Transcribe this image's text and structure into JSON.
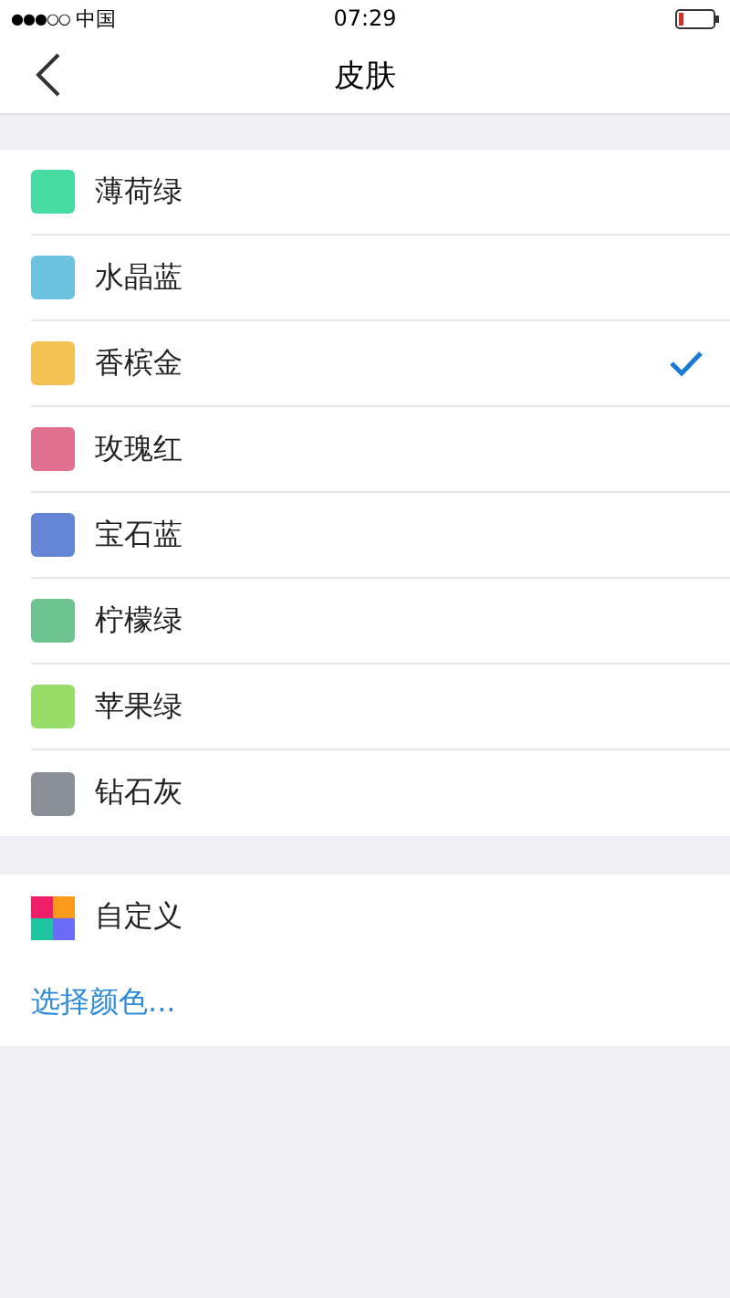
{
  "status_bar": {
    "signal": "●●●○○",
    "carrier": "中国",
    "time": "07:29"
  },
  "nav": {
    "title": "皮肤"
  },
  "skins": [
    {
      "name": "薄荷绿",
      "color": "#45dba3",
      "selected": false
    },
    {
      "name": "水晶蓝",
      "color": "#6cc3e0",
      "selected": false
    },
    {
      "name": "香槟金",
      "color": "#f3c252",
      "selected": true
    },
    {
      "name": "玫瑰红",
      "color": "#e07090",
      "selected": false
    },
    {
      "name": "宝石蓝",
      "color": "#6585d4",
      "selected": false
    },
    {
      "name": "柠檬绿",
      "color": "#6cc38f",
      "selected": false
    },
    {
      "name": "苹果绿",
      "color": "#97dd68",
      "selected": false
    },
    {
      "name": "钻石灰",
      "color": "#8a8f98",
      "selected": false
    }
  ],
  "custom": {
    "name": "自定义",
    "action": "选择颜色..."
  }
}
